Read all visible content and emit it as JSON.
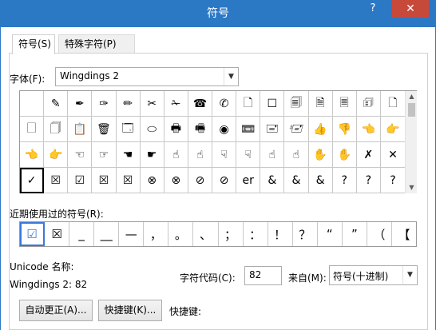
{
  "window": {
    "title": "符号",
    "help": "?",
    "close": "✕"
  },
  "tabs": [
    {
      "label": "符号(S)"
    },
    {
      "label": "特殊字符(P)"
    }
  ],
  "font": {
    "label": "字体(F):",
    "value": "Wingdings 2"
  },
  "symbol_grid": {
    "selected_index": 48,
    "rows": [
      [
        "",
        "✎",
        "✒",
        "✑",
        "✏",
        "✂",
        "✁",
        "☎",
        "✆",
        "🗋",
        "☐",
        "🗐",
        "🗎",
        "🗏",
        "🗊",
        "🗋"
      ],
      [
        "🗌",
        "🗍",
        "📋",
        "🗑",
        "🗔",
        "⬭",
        "🖶",
        "🖷",
        "◉",
        "📼",
        "🖃",
        "🖅",
        "👍",
        "👎",
        "👈",
        "👉"
      ],
      [
        "👈",
        "👉",
        "☜",
        "☞",
        "☚",
        "☛",
        "☝",
        "☝",
        "☟",
        "☟",
        "☝",
        "☝",
        "✋",
        "✋",
        "✗",
        "✕"
      ],
      [
        "✓",
        "☒",
        "☑",
        "☒",
        "☒",
        "⊗",
        "⊗",
        "⊘",
        "⊘",
        "er",
        "&",
        "&",
        "&",
        "?",
        "?",
        "?"
      ]
    ]
  },
  "recent": {
    "label": "近期使用过的符号(R):",
    "symbols": [
      "☑",
      "☒",
      "_",
      "__",
      "—",
      "，",
      "。",
      "、",
      "；",
      "：",
      "！",
      "？",
      "“",
      "”",
      "（",
      "【"
    ]
  },
  "info": {
    "unicode_label": "Unicode 名称:",
    "char_desc": "Wingdings 2: 82",
    "code_label": "字符代码(C):",
    "code_value": "82",
    "from_label": "来自(M):",
    "from_value": "符号(十进制)"
  },
  "buttons": {
    "autocorrect": "自动更正(A)...",
    "shortcut": "快捷键(K)...",
    "shortcut_label": "快捷键:"
  }
}
